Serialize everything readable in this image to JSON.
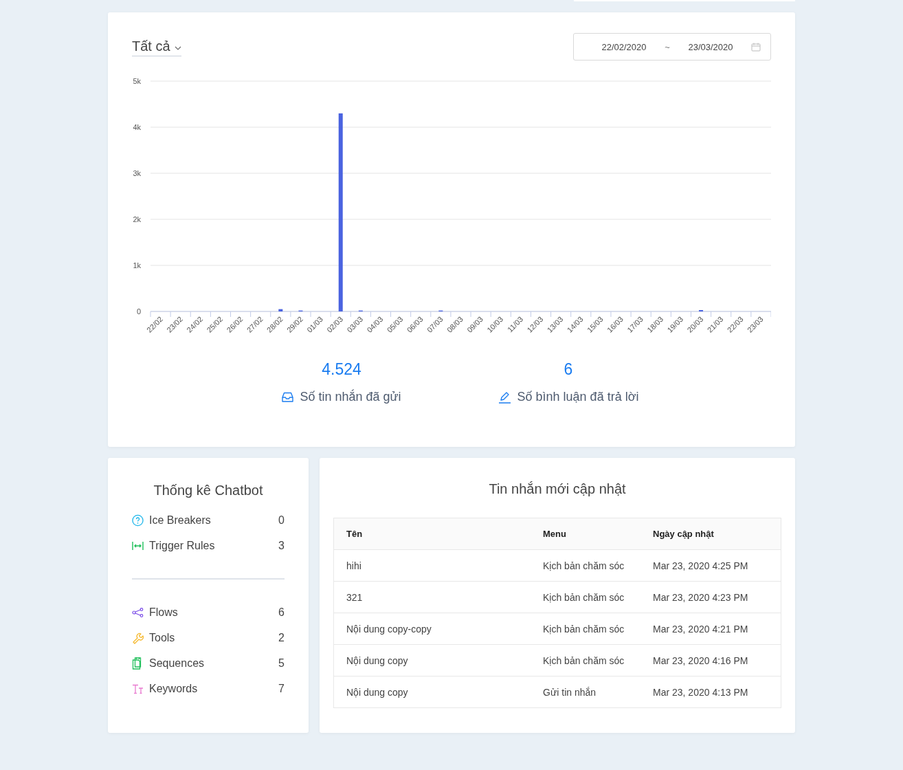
{
  "filter": {
    "label": "Tất cả"
  },
  "date_range": {
    "start": "22/02/2020",
    "separator": "~",
    "end": "23/03/2020"
  },
  "chart_data": {
    "type": "bar",
    "categories": [
      "22/02",
      "23/02",
      "24/02",
      "25/02",
      "26/02",
      "27/02",
      "28/02",
      "29/02",
      "01/03",
      "02/03",
      "03/03",
      "04/03",
      "05/03",
      "06/03",
      "07/03",
      "08/03",
      "09/03",
      "10/03",
      "11/03",
      "12/03",
      "13/03",
      "14/03",
      "15/03",
      "16/03",
      "17/03",
      "18/03",
      "19/03",
      "20/03",
      "21/03",
      "22/03",
      "23/03"
    ],
    "values": [
      0,
      0,
      0,
      0,
      0,
      0,
      50,
      20,
      0,
      4300,
      20,
      0,
      0,
      0,
      20,
      0,
      0,
      0,
      0,
      0,
      0,
      0,
      0,
      0,
      0,
      0,
      0,
      30,
      0,
      0,
      0
    ],
    "grid": true,
    "ylim": [
      0,
      5000
    ],
    "yticks": [
      {
        "value": 0,
        "label": "0"
      },
      {
        "value": 1000,
        "label": "1k"
      },
      {
        "value": 2000,
        "label": "2k"
      },
      {
        "value": 3000,
        "label": "3k"
      },
      {
        "value": 4000,
        "label": "4k"
      },
      {
        "value": 5000,
        "label": "5k"
      }
    ]
  },
  "totals": [
    {
      "kind": "messages",
      "value": "4.524",
      "label": "Số tin nhắn đã gửi"
    },
    {
      "kind": "comments",
      "value": "6",
      "label": "Số bình luận đã trả lời"
    }
  ],
  "chatbot_stats": {
    "title": "Thống kê Chatbot",
    "groups": [
      [
        {
          "kind": "question",
          "label": "Ice Breakers",
          "count": "0"
        },
        {
          "kind": "trigger",
          "label": "Trigger Rules",
          "count": "3"
        }
      ],
      [
        {
          "kind": "flows",
          "label": "Flows",
          "count": "6"
        },
        {
          "kind": "tools",
          "label": "Tools",
          "count": "2"
        },
        {
          "kind": "sequences",
          "label": "Sequences",
          "count": "5"
        },
        {
          "kind": "keywords",
          "label": "Keywords",
          "count": "7"
        }
      ]
    ]
  },
  "recent_messages": {
    "title": "Tin nhắn mới cập nhật",
    "columns": [
      "Tên",
      "Menu",
      "Ngày cập nhật"
    ],
    "rows": [
      [
        "hihi",
        "Kịch bản chăm sóc",
        "Mar 23, 2020 4:25 PM"
      ],
      [
        "321",
        "Kịch bản chăm sóc",
        "Mar 23, 2020 4:23 PM"
      ],
      [
        "Nội dung copy-copy",
        "Kịch bản chăm sóc",
        "Mar 23, 2020 4:21 PM"
      ],
      [
        "Nội dung copy",
        "Kịch bản chăm sóc",
        "Mar 23, 2020 4:16 PM"
      ],
      [
        "Nội dung copy",
        "Gửi tin nhắn",
        "Mar 23, 2020 4:13 PM"
      ]
    ]
  }
}
